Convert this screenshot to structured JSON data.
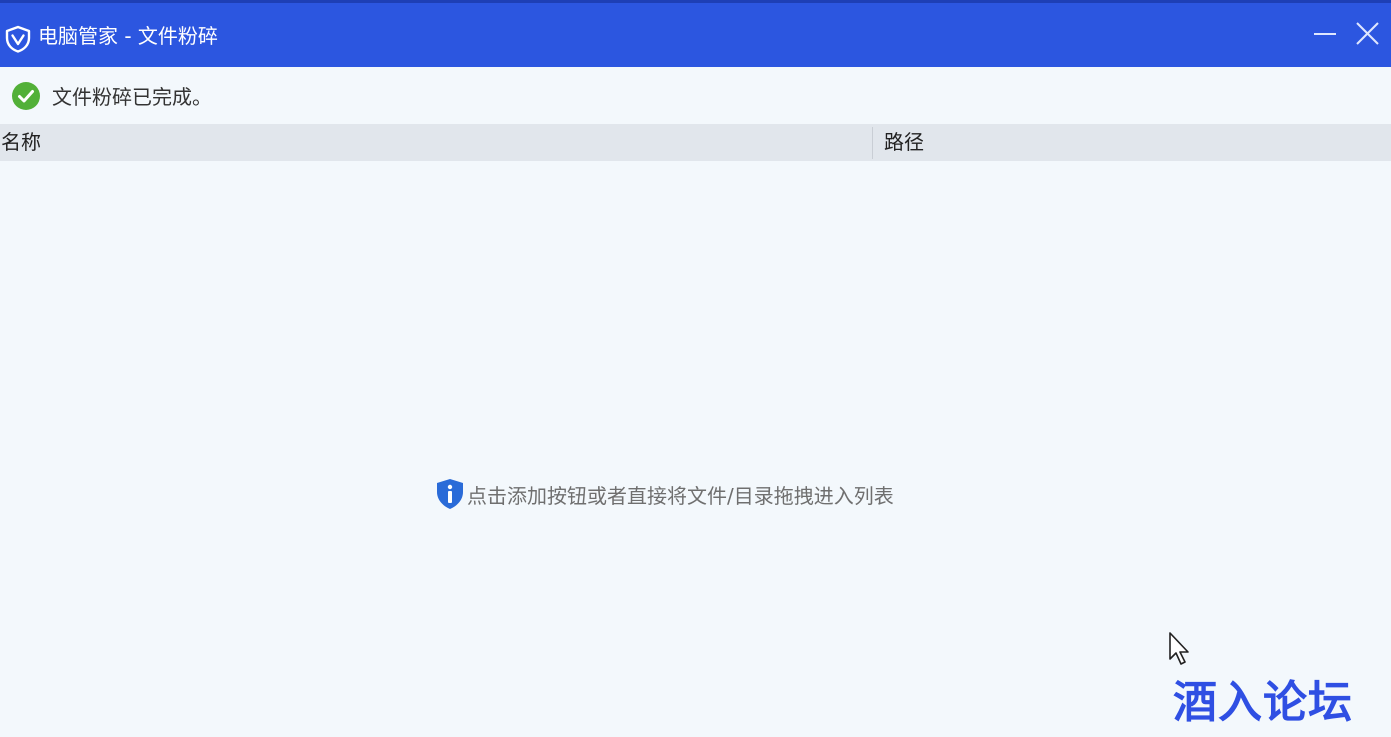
{
  "window": {
    "title": "电脑管家 - 文件粉碎",
    "titlebar_color": "#2c56e0",
    "icons": {
      "logo": "shield-logo-icon",
      "minimize": "minimize-icon",
      "close": "close-icon"
    }
  },
  "status": {
    "icon": "check-circle-icon",
    "text": "文件粉碎已完成。",
    "icon_color": "#52b038"
  },
  "table": {
    "columns": [
      {
        "label": "名称"
      },
      {
        "label": "路径"
      }
    ],
    "rows": []
  },
  "empty_state": {
    "icon": "info-shield-icon",
    "icon_color": "#2a6bd8",
    "text": "点击添加按钮或者直接将文件/目录拖拽进入列表"
  },
  "watermark": {
    "text": "酒入论坛",
    "color": "#2f4fe3"
  }
}
